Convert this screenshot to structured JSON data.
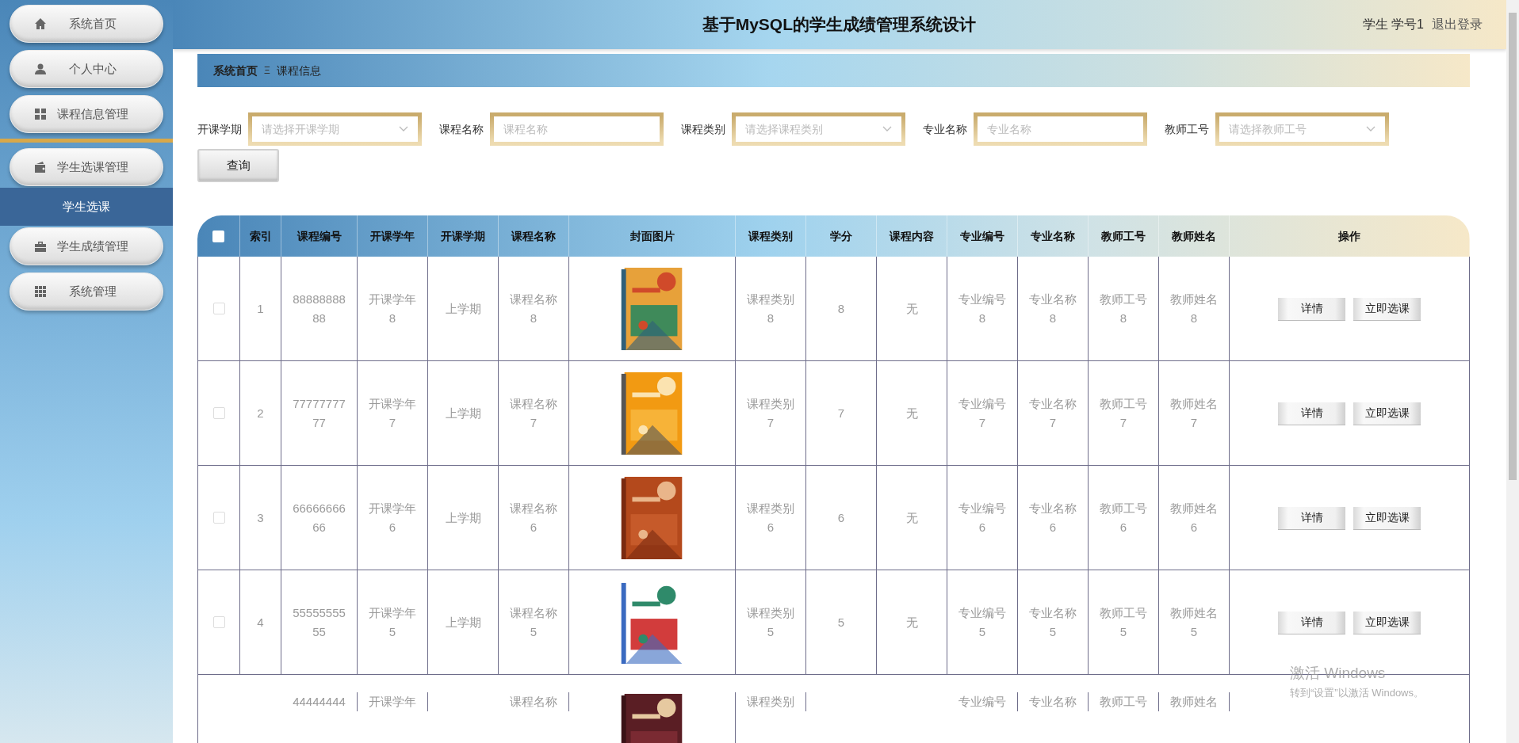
{
  "sidebar": {
    "items": [
      {
        "label": "系统首页",
        "kind": "menu",
        "selected": false
      },
      {
        "label": "个人中心",
        "kind": "menu",
        "selected": false
      },
      {
        "label": "课程信息管理",
        "kind": "menu",
        "selected": false
      },
      {
        "kind": "divider"
      },
      {
        "label": "学生选课管理",
        "kind": "menu",
        "selected": false
      },
      {
        "label": "学生选课",
        "kind": "submenu",
        "selected": true
      },
      {
        "label": "学生成绩管理",
        "kind": "menu",
        "selected": false
      },
      {
        "label": "系统管理",
        "kind": "menu",
        "selected": false
      }
    ]
  },
  "header": {
    "title": "基于MySQL的学生成绩管理系统设计",
    "user": "学生 学号1",
    "logout": "退出登录"
  },
  "breadcrumb": {
    "home": "系统首页",
    "separator": "Ξ",
    "current": "课程信息"
  },
  "filters": [
    {
      "label": "开课学期",
      "kind": "select",
      "placeholder": "请选择开课学期"
    },
    {
      "label": "课程名称",
      "kind": "input",
      "placeholder": "课程名称"
    },
    {
      "label": "课程类别",
      "kind": "select",
      "placeholder": "请选择课程类别"
    },
    {
      "label": "专业名称",
      "kind": "input",
      "placeholder": "专业名称"
    },
    {
      "label": "教师工号",
      "kind": "select",
      "placeholder": "请选择教师工号"
    }
  ],
  "query_button": "查询",
  "table": {
    "select_all_checked": false,
    "columns": [
      "索引",
      "课程编号",
      "开课学年",
      "开课学期",
      "课程名称",
      "封面图片",
      "课程类别",
      "学分",
      "课程内容",
      "专业编号",
      "专业名称",
      "教师工号",
      "教师姓名",
      "操作"
    ],
    "rows": [
      {
        "checked": false,
        "cells": [
          "1",
          "8888888888",
          "开课学年8",
          "上学期",
          "课程名称8",
          {
            "kind": "picture"
          },
          "课程类别8",
          "8",
          "无",
          "专业编号8",
          "专业名称8",
          "教师工号8",
          "教师姓名8"
        ],
        "actions": [
          "详情",
          "立即选课"
        ]
      },
      {
        "checked": false,
        "cells": [
          "2",
          "7777777777",
          "开课学年7",
          "上学期",
          "课程名称7",
          {
            "kind": "picture"
          },
          "课程类别7",
          "7",
          "无",
          "专业编号7",
          "专业名称7",
          "教师工号7",
          "教师姓名7"
        ],
        "actions": [
          "详情",
          "立即选课"
        ]
      },
      {
        "checked": false,
        "cells": [
          "3",
          "6666666666",
          "开课学年6",
          "上学期",
          "课程名称6",
          {
            "kind": "picture"
          },
          "课程类别6",
          "6",
          "无",
          "专业编号6",
          "专业名称6",
          "教师工号6",
          "教师姓名6"
        ],
        "actions": [
          "详情",
          "立即选课"
        ]
      },
      {
        "checked": false,
        "cells": [
          "4",
          "5555555555",
          "开课学年5",
          "上学期",
          "课程名称5",
          {
            "kind": "picture"
          },
          "课程类别5",
          "5",
          "无",
          "专业编号5",
          "专业名称5",
          "教师工号5",
          "教师姓名5"
        ],
        "actions": [
          "详情",
          "立即选课"
        ]
      },
      {
        "cells": [
          "",
          "44444444",
          "开课学年",
          "",
          "课程名称",
          {
            "kind": "picture"
          },
          "课程类别",
          "",
          "",
          "专业编号",
          "专业名称",
          "教师工号",
          "教师姓名"
        ]
      }
    ]
  },
  "os_notice": {
    "title": "激活 Windows",
    "text": "转到“设置”以激活 Windows。"
  }
}
